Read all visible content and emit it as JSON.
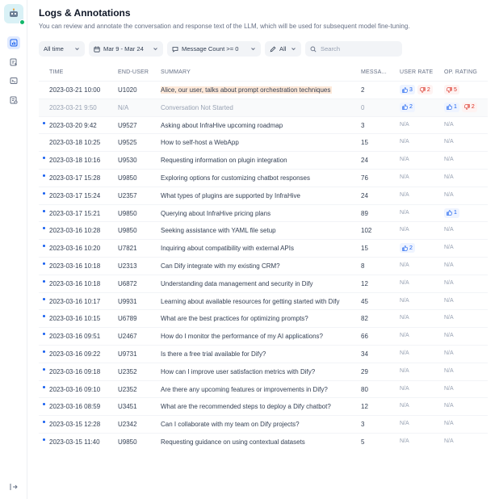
{
  "sidebar": {
    "nav": [
      {
        "name": "overview-icon",
        "active": true
      },
      {
        "name": "logs-icon",
        "active": false
      },
      {
        "name": "terminal-icon",
        "active": false
      },
      {
        "name": "annotations-icon",
        "active": false
      }
    ]
  },
  "header": {
    "title": "Logs & Annotations",
    "subtitle": "You can review and annotate the conversation and response text of the LLM, which will be used for subsequent model fine-tuning."
  },
  "filters": {
    "period": "All time",
    "date_range": "Mar 9 - Mar 24",
    "message_count": "Message Count >= 0",
    "annotation": "All",
    "search_placeholder": "Search"
  },
  "table": {
    "columns": [
      "TIME",
      "END-USER",
      "SUMMARY",
      "MESSA...",
      "USER RATE",
      "OP. RATING"
    ],
    "rows": [
      {
        "unread": false,
        "time": "2023-03-21 10:00",
        "user": "U1020",
        "summary_lead": "Alice",
        "summary": ", our user, talks about prompt orchestration techniques",
        "messages": "2",
        "user_like": "3",
        "user_dislike": "2",
        "op_like": "",
        "op_dislike": "5"
      },
      {
        "unread": false,
        "time": "2023-03-21 9:50",
        "user": "N/A",
        "summary_lead": "",
        "summary": "Conversation Not Started",
        "messages": "0",
        "user_like": "2",
        "user_dislike": "",
        "op_like": "1",
        "op_dislike": "2"
      },
      {
        "unread": true,
        "time": "2023-03-20 9:42",
        "user": "U9527",
        "summary_lead": "",
        "summary": "Asking about InfraHive upcoming roadmap",
        "messages": "3",
        "user_rate": "N/A",
        "op_rate": "N/A"
      },
      {
        "unread": false,
        "time": "2023-03-18 10:25",
        "user": "U9525",
        "summary_lead": "",
        "summary": "How to self-host a WebApp",
        "messages": "15",
        "user_rate": "N/A",
        "op_rate": "N/A"
      },
      {
        "unread": true,
        "time": "2023-03-18 10:16",
        "user": "U9530",
        "summary_lead": "",
        "summary": "Requesting information on plugin integration",
        "messages": "24",
        "user_rate": "N/A",
        "op_rate": "N/A"
      },
      {
        "unread": true,
        "time": "2023-03-17 15:28",
        "user": "U9850",
        "summary_lead": "",
        "summary": "Exploring options for customizing chatbot responses",
        "messages": "76",
        "user_rate": "N/A",
        "op_rate": "N/A"
      },
      {
        "unread": true,
        "time": "2023-03-17 15:24",
        "user": "U2357",
        "summary_lead": "",
        "summary": "What types of plugins are supported by InfraHive",
        "messages": "24",
        "user_rate": "N/A",
        "op_rate": "N/A"
      },
      {
        "unread": true,
        "time": "2023-03-17 15:21",
        "user": "U9850",
        "summary_lead": "",
        "summary": "Querying about InfraHive pricing plans",
        "messages": "89",
        "user_rate": "N/A",
        "op_like": "1"
      },
      {
        "unread": true,
        "time": "2023-03-16 10:28",
        "user": "U9850",
        "summary_lead": "",
        "summary": "Seeking assistance with YAML file setup",
        "messages": "102",
        "user_rate": "N/A",
        "op_rate": "N/A"
      },
      {
        "unread": true,
        "time": "2023-03-16 10:20",
        "user": "U7821",
        "summary_lead": "",
        "summary": "Inquiring about compatibility with external APIs",
        "messages": "15",
        "user_like": "2",
        "op_rate": "N/A"
      },
      {
        "unread": true,
        "time": "2023-03-16 10:18",
        "user": "U2313",
        "summary_lead": "",
        "summary": "Can Dify integrate with my existing CRM?",
        "messages": "8",
        "user_rate": "N/A",
        "op_rate": "N/A"
      },
      {
        "unread": true,
        "time": "2023-03-16 10:18",
        "user": "U6872",
        "summary_lead": "",
        "summary": "Understanding data management and security in Dify",
        "messages": "12",
        "user_rate": "N/A",
        "op_rate": "N/A"
      },
      {
        "unread": true,
        "time": "2023-03-16 10:17",
        "user": "U9931",
        "summary_lead": "",
        "summary": "Learning about available resources for getting started with Dify",
        "messages": "45",
        "user_rate": "N/A",
        "op_rate": "N/A"
      },
      {
        "unread": true,
        "time": "2023-03-16 10:15",
        "user": "U6789",
        "summary_lead": "",
        "summary": "What are the best practices for optimizing prompts?",
        "messages": "82",
        "user_rate": "N/A",
        "op_rate": "N/A"
      },
      {
        "unread": true,
        "time": "2023-03-16 09:51",
        "user": "U2467",
        "summary_lead": "",
        "summary": "How do I monitor the performance of my AI applications?",
        "messages": "66",
        "user_rate": "N/A",
        "op_rate": "N/A"
      },
      {
        "unread": true,
        "time": "2023-03-16 09:22",
        "user": "U9731",
        "summary_lead": "",
        "summary": "Is there a free trial available for Dify?",
        "messages": "34",
        "user_rate": "N/A",
        "op_rate": "N/A"
      },
      {
        "unread": true,
        "time": "2023-03-16 09:18",
        "user": "U2352",
        "summary_lead": "",
        "summary": "How can I improve user satisfaction metrics with Dify?",
        "messages": "29",
        "user_rate": "N/A",
        "op_rate": "N/A"
      },
      {
        "unread": true,
        "time": "2023-03-16 09:10",
        "user": "U2352",
        "summary_lead": "",
        "summary": "Are there any upcoming features or improvements in Dify?",
        "messages": "80",
        "user_rate": "N/A",
        "op_rate": "N/A"
      },
      {
        "unread": true,
        "time": "2023-03-16 08:59",
        "user": "U3451",
        "summary_lead": "",
        "summary": "What are the recommended steps to deploy a Dify chatbot?",
        "messages": "12",
        "user_rate": "N/A",
        "op_rate": "N/A"
      },
      {
        "unread": true,
        "time": "2023-03-15 12:28",
        "user": "U2342",
        "summary_lead": "",
        "summary": "Can I collaborate with my team on Dify projects?",
        "messages": "3",
        "user_rate": "N/A",
        "op_rate": "N/A"
      },
      {
        "unread": true,
        "time": "2023-03-15 11:40",
        "user": "U9850",
        "summary_lead": "",
        "summary": "Requesting guidance on using contextual datasets",
        "messages": "5",
        "user_rate": "N/A",
        "op_rate": "N/A"
      }
    ]
  },
  "colors": {
    "accent": "#155eef",
    "like_bg": "#eff4ff",
    "dislike": "#d92d20",
    "dislike_bg": "#fef3f2",
    "highlight": "#fde8d8",
    "status_online": "#12b76a"
  }
}
